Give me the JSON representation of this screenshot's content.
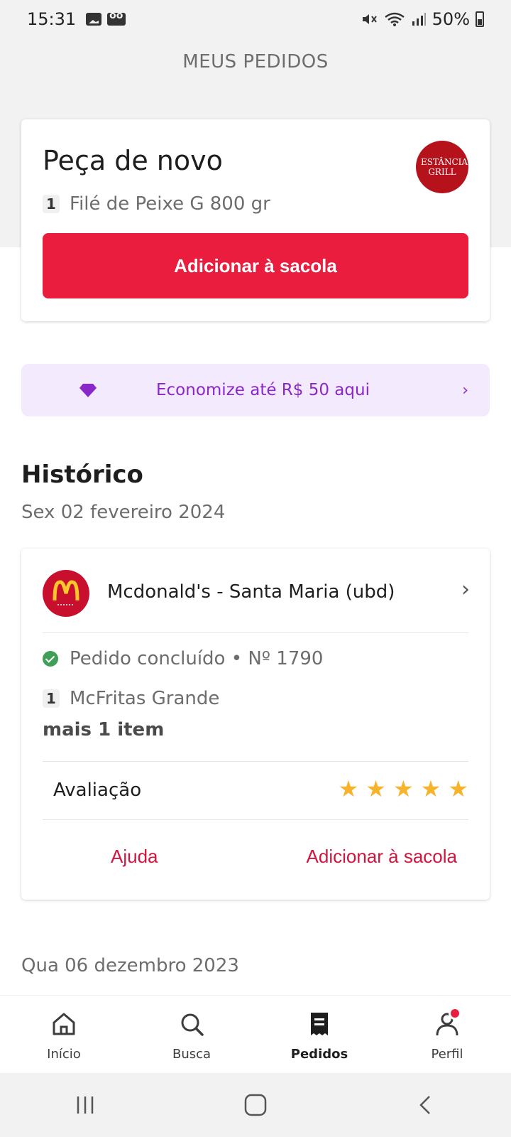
{
  "status_bar": {
    "time": "15:31",
    "battery": "50%"
  },
  "header": {
    "title": "MEUS PEDIDOS"
  },
  "reorder": {
    "title": "Peça de novo",
    "item_qty": "1",
    "item_name": "Filé de Peixe G 800 gr",
    "restaurant_logo_text": "ESTÂNCIA GRILL",
    "button_label": "Adicionar à sacola"
  },
  "promo": {
    "text": "Economize até R$ 50 aqui",
    "icon": "diamond-icon"
  },
  "history": {
    "title": "Histórico",
    "groups": [
      {
        "date": "Sex 02 fevereiro 2024",
        "order": {
          "restaurant": "Mcdonald's - Santa Maria (ubd)",
          "status": "Pedido concluído • Nº 1790",
          "item_qty": "1",
          "item_name": "McFritas Grande",
          "more": "mais 1 item",
          "rating_label": "Avaliação",
          "rating": 5,
          "help_label": "Ajuda",
          "add_label": "Adicionar à sacola"
        }
      },
      {
        "date": "Qua 06 dezembro 2023"
      }
    ]
  },
  "bottom_nav": {
    "items": [
      {
        "label": "Início",
        "icon": "home-icon"
      },
      {
        "label": "Busca",
        "icon": "search-icon"
      },
      {
        "label": "Pedidos",
        "icon": "receipt-icon",
        "active": true
      },
      {
        "label": "Perfil",
        "icon": "profile-icon"
      }
    ]
  },
  "colors": {
    "primary": "#ea1d3e",
    "promo": "#8a27c9",
    "star": "#f7b32b",
    "success": "#3f9e57"
  }
}
